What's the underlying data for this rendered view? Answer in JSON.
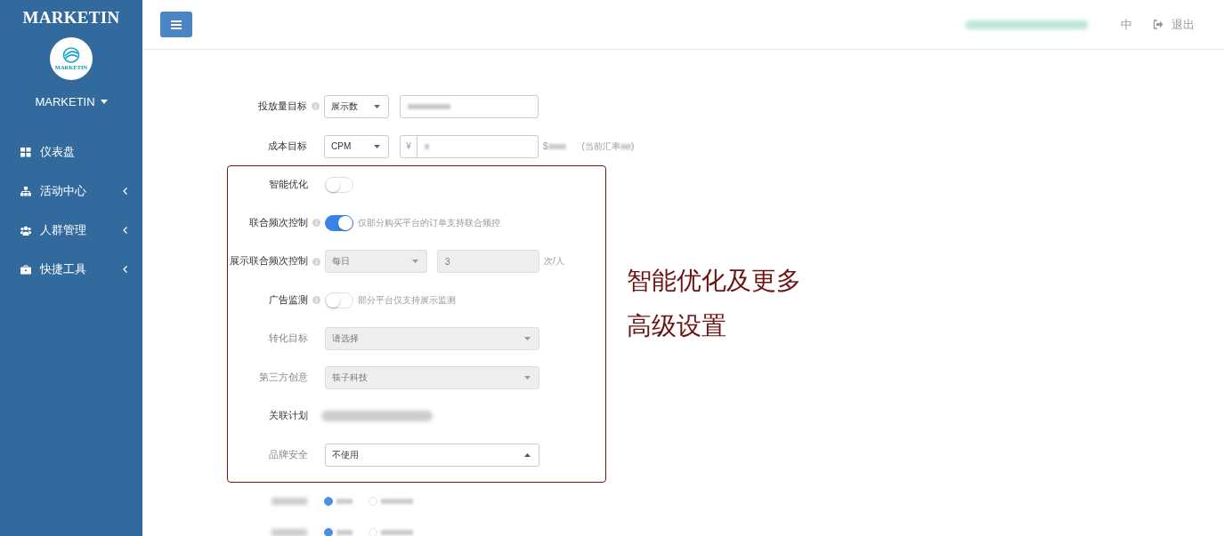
{
  "sidebar": {
    "brand": "MARKETIN",
    "logo_text": "MARKETIN",
    "user": "MARKETIN",
    "items": [
      {
        "label": "仪表盘",
        "expandable": false
      },
      {
        "label": "活动中心",
        "expandable": true
      },
      {
        "label": "人群管理",
        "expandable": true
      },
      {
        "label": "快捷工具",
        "expandable": true
      }
    ]
  },
  "header": {
    "language": "中",
    "logout": "退出"
  },
  "form": {
    "rows": [
      {
        "kind": "select_input",
        "label": "投放量目标",
        "info": true,
        "dimmed": false,
        "select": "展示数",
        "disabled": false
      },
      {
        "kind": "cost",
        "label": "成本目标",
        "info": false,
        "dimmed": false,
        "select": "CPM",
        "prefix": "¥",
        "currency": "$",
        "rate_label": "(当前汇率",
        "rate_close": ")",
        "disabled": false
      }
    ],
    "advanced_rows": [
      {
        "kind": "toggle",
        "label": "智能优化",
        "info": false,
        "dimmed": false,
        "on": false
      },
      {
        "kind": "toggle",
        "label": "联合频次控制",
        "info": true,
        "dimmed": false,
        "on": true,
        "note": "仅部分购买平台的订单支持联合频控"
      },
      {
        "kind": "frequency",
        "label": "展示联合频次控制",
        "info": true,
        "dimmed": false,
        "select": "每日",
        "value": "3",
        "unit": "次/人",
        "disabled": true
      },
      {
        "kind": "toggle",
        "label": "广告监测",
        "info": true,
        "dimmed": false,
        "on": false,
        "note": "部分平台仅支持展示监测"
      },
      {
        "kind": "select",
        "label": "转化目标",
        "info": false,
        "dimmed": true,
        "select": "请选择",
        "disabled": true,
        "open": false
      },
      {
        "kind": "select",
        "label": "第三方创意",
        "info": false,
        "dimmed": true,
        "select": "筷子科技",
        "disabled": true,
        "open": false
      },
      {
        "kind": "blurred",
        "label": "关联计划",
        "info": false,
        "dimmed": false
      },
      {
        "kind": "select",
        "label": "品牌安全",
        "info": false,
        "dimmed": true,
        "select": "不使用",
        "disabled": false,
        "open": true
      }
    ],
    "trailing_rows": [
      {
        "kind": "radios",
        "options": [
          {
            "selected": true
          },
          {
            "selected": false
          }
        ]
      },
      {
        "kind": "radios",
        "options": [
          {
            "selected": true
          },
          {
            "selected": false
          }
        ]
      }
    ]
  },
  "annotation": {
    "lines": [
      "智能优化及更多",
      "高级设置"
    ]
  }
}
